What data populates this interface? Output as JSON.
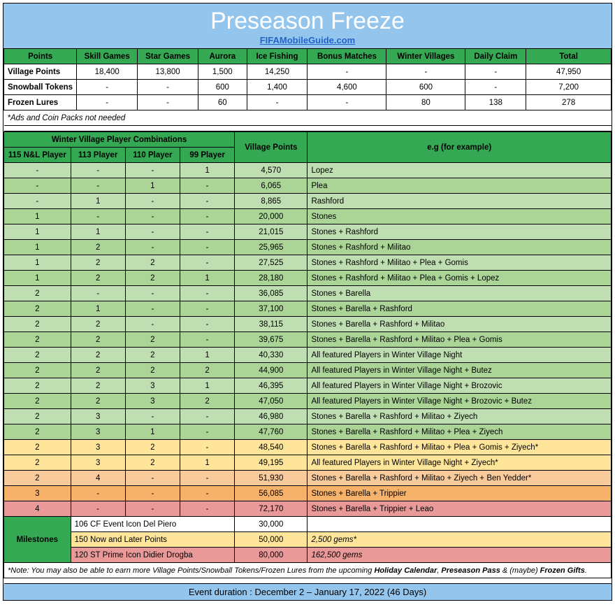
{
  "title": "Preseason Freeze",
  "subtitle_link": "FIFAMobileGuide.com",
  "points_headers": [
    "Points",
    "Skill Games",
    "Star Games",
    "Aurora",
    "Ice Fishing",
    "Bonus Matches",
    "Winter Villages",
    "Daily Claim",
    "Total"
  ],
  "points_rows": [
    {
      "label": "Village Points",
      "cells": [
        "18,400",
        "13,800",
        "1,500",
        "14,250",
        "-",
        "-",
        "-",
        "47,950"
      ]
    },
    {
      "label": "Snowball Tokens",
      "cells": [
        "-",
        "-",
        "600",
        "1,400",
        "4,600",
        "600",
        "-",
        "7,200"
      ]
    },
    {
      "label": "Frozen Lures",
      "cells": [
        "-",
        "-",
        "60",
        "-",
        "-",
        "80",
        "138",
        "278"
      ]
    }
  ],
  "points_note": "*Ads and Coin Packs not needed",
  "combo_top_header": "Winter Village Player Combinations",
  "combo_sub_headers": [
    "115 N&L Player",
    "113 Player",
    "110 Player",
    "99 Player"
  ],
  "village_points_h": "Village Points",
  "example_h": "e.g (for example)",
  "combo_rows": [
    {
      "cls": "g1",
      "c": [
        "-",
        "-",
        "-",
        "1",
        "4,570",
        "Lopez"
      ]
    },
    {
      "cls": "g2",
      "c": [
        "-",
        "-",
        "1",
        "-",
        "6,065",
        "Plea"
      ]
    },
    {
      "cls": "g3",
      "c": [
        "-",
        "1",
        "-",
        "-",
        "8,865",
        "Rashford"
      ]
    },
    {
      "cls": "g4",
      "c": [
        "1",
        "-",
        "-",
        "-",
        "20,000",
        "Stones"
      ]
    },
    {
      "cls": "g5",
      "c": [
        "1",
        "1",
        "-",
        "-",
        "21,015",
        "Stones + Rashford"
      ]
    },
    {
      "cls": "g6",
      "c": [
        "1",
        "2",
        "-",
        "-",
        "25,965",
        "Stones + Rashford + Militao"
      ]
    },
    {
      "cls": "g7",
      "c": [
        "1",
        "2",
        "2",
        "-",
        "27,525",
        "Stones + Rashford + Militao + Plea + Gomis"
      ]
    },
    {
      "cls": "g8",
      "c": [
        "1",
        "2",
        "2",
        "1",
        "28,180",
        "Stones + Rashford + Militao + Plea + Gomis + Lopez"
      ]
    },
    {
      "cls": "g9",
      "c": [
        "2",
        "-",
        "-",
        "-",
        "36,085",
        "Stones + Barella"
      ]
    },
    {
      "cls": "g10",
      "c": [
        "2",
        "1",
        "-",
        "-",
        "37,100",
        "Stones + Barella + Rashford"
      ]
    },
    {
      "cls": "g11",
      "c": [
        "2",
        "2",
        "-",
        "-",
        "38,115",
        "Stones + Barella + Rashford + Militao"
      ]
    },
    {
      "cls": "g12",
      "c": [
        "2",
        "2",
        "2",
        "-",
        "39,675",
        "Stones + Barella + Rashford + Militao + Plea + Gomis"
      ]
    },
    {
      "cls": "g13",
      "c": [
        "2",
        "2",
        "2",
        "1",
        "40,330",
        "All featured Players in Winter Village Night"
      ]
    },
    {
      "cls": "g14",
      "c": [
        "2",
        "2",
        "2",
        "2",
        "44,900",
        "All featured Players in Winter Village Night + Butez"
      ]
    },
    {
      "cls": "g15",
      "c": [
        "2",
        "2",
        "3",
        "1",
        "46,395",
        "All featured Players in Winter Village Night + Brozovic"
      ]
    },
    {
      "cls": "g16",
      "c": [
        "2",
        "2",
        "3",
        "2",
        "47,050",
        "All featured Players in Winter Village Night + Brozovic + Butez"
      ]
    },
    {
      "cls": "g17",
      "c": [
        "2",
        "3",
        "-",
        "-",
        "46,980",
        "Stones + Barella + Rashford + Militao + Ziyech"
      ]
    },
    {
      "cls": "g18",
      "c": [
        "2",
        "3",
        "1",
        "-",
        "47,760",
        "Stones + Barella + Rashford + Militao + Plea + Ziyech"
      ]
    },
    {
      "cls": "y1",
      "c": [
        "2",
        "3",
        "2",
        "-",
        "48,540",
        "Stones + Barella + Rashford + Militao + Plea + Gomis + Ziyech*"
      ]
    },
    {
      "cls": "y1",
      "c": [
        "2",
        "3",
        "2",
        "1",
        "49,195",
        "All featured Players in Winter Village Night + Ziyech*"
      ]
    },
    {
      "cls": "o1",
      "c": [
        "2",
        "4",
        "-",
        "-",
        "51,930",
        "Stones + Barella + Rashford + Militao + Ziyech + Ben Yedder*"
      ]
    },
    {
      "cls": "o2",
      "c": [
        "3",
        "-",
        "-",
        "-",
        "56,085",
        "Stones + Barella + Trippier"
      ]
    },
    {
      "cls": "r1",
      "c": [
        "4",
        "-",
        "-",
        "-",
        "72,170",
        "Stones + Barella + Trippier + Leao"
      ]
    }
  ],
  "milestones_label": "Milestones",
  "milestones": [
    {
      "cls": "",
      "desc": "106 CF Event Icon Del Piero",
      "pts": "30,000",
      "note": ""
    },
    {
      "cls": "m-y",
      "desc": "150 Now and Later Points",
      "pts": "50,000",
      "note": "2,500 gems*"
    },
    {
      "cls": "m-r",
      "desc": "120 ST Prime Icon Didier Drogba",
      "pts": "80,000",
      "note": "162,500 gems"
    }
  ],
  "bottom_note_pre": "*Note: You may also be able to earn more Village Points/Snowball Tokens/Frozen Lures from the upcoming ",
  "bottom_note_b1": "Holiday Calendar",
  "bottom_note_mid1": ", ",
  "bottom_note_b2": "Preseason Pass",
  "bottom_note_mid2": " & (maybe) ",
  "bottom_note_b3": "Frozen Gifts",
  "bottom_note_end": ".",
  "footer": "Event duration : December 2 – January 17, 2022 (46 Days)"
}
